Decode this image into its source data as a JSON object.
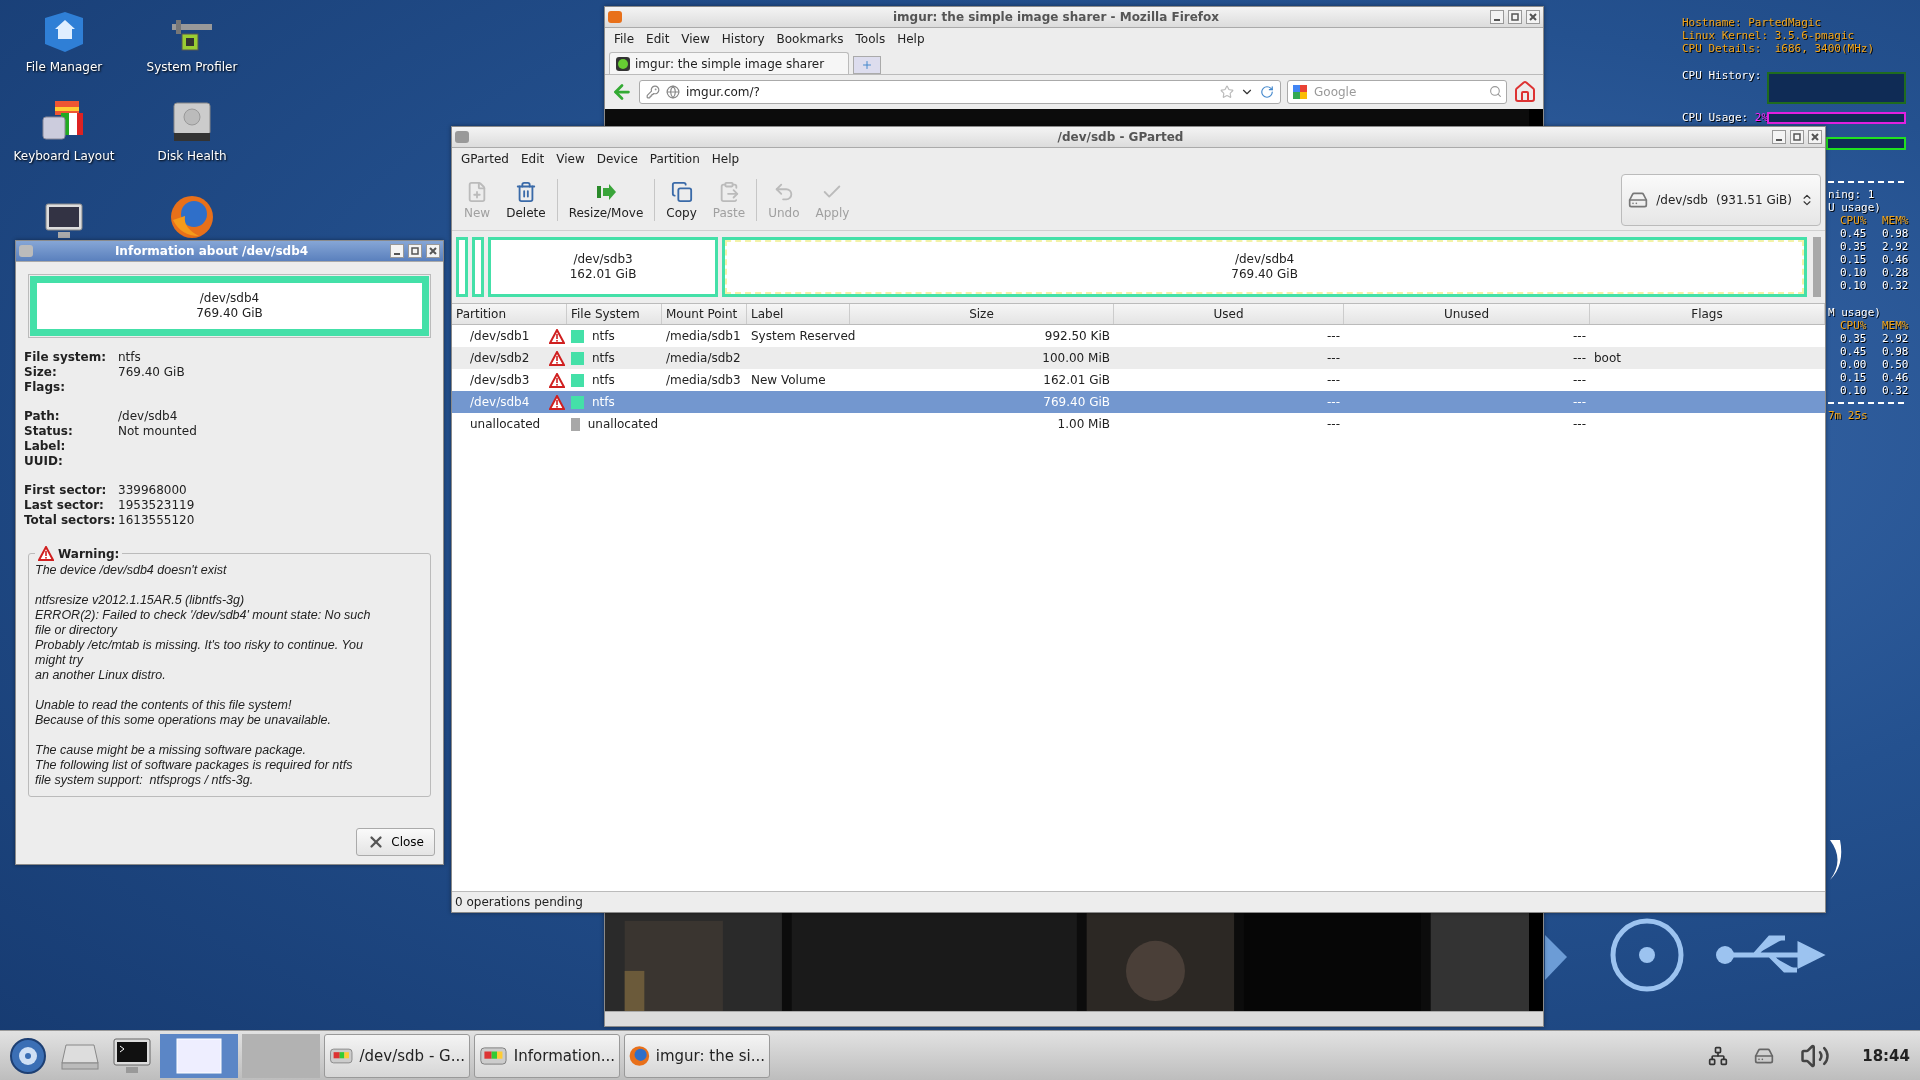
{
  "desktop_icons": [
    {
      "kind": "file_manager",
      "label": "File Manager"
    },
    {
      "kind": "profiler",
      "label": "System Profiler"
    },
    {
      "kind": "keyboard",
      "label": "Keyboard Layout"
    },
    {
      "kind": "disk",
      "label": "Disk Health"
    },
    {
      "kind": "monitor"
    },
    {
      "kind": "browser"
    }
  ],
  "system_monitor": {
    "info_lines": [
      "Hostname: PartedMagic",
      "Linux Kernel: 3.5.6-pmagic",
      "CPU Details:  i686, 3400(MHz)"
    ],
    "cpu_history_label": "CPU History:",
    "cpu_usage": {
      "label": "CPU Usage:",
      "value": "2%"
    },
    "running_fragment": "ning: 1",
    "tables": [
      {
        "heading": "U usage)",
        "columns": [
          "CPU%",
          "MEM%"
        ],
        "rows": [
          [
            "0.45",
            "0.98"
          ],
          [
            "0.35",
            "2.92"
          ],
          [
            "0.15",
            "0.46"
          ],
          [
            "0.10",
            "0.28"
          ],
          [
            "0.10",
            "0.32"
          ]
        ]
      },
      {
        "heading": "M usage)",
        "columns": [
          "CPU%",
          "MEM%"
        ],
        "rows": [
          [
            "0.35",
            "2.92"
          ],
          [
            "0.45",
            "0.98"
          ],
          [
            "0.00",
            "0.50"
          ],
          [
            "0.15",
            "0.46"
          ],
          [
            "0.10",
            "0.32"
          ]
        ]
      }
    ],
    "uptime_fragment": "7m 25s"
  },
  "firefox": {
    "title": "imgur: the simple image sharer - Mozilla Firefox",
    "menu": [
      "File",
      "Edit",
      "View",
      "History",
      "Bookmarks",
      "Tools",
      "Help"
    ],
    "tab": "imgur: the simple image sharer",
    "address": "imgur.com/?",
    "search_placeholder": "Google"
  },
  "gparted": {
    "title": "/dev/sdb - GParted",
    "menu": [
      "GParted",
      "Edit",
      "View",
      "Device",
      "Partition",
      "Help"
    ],
    "toolbar": [
      {
        "kind": "new",
        "label": "New",
        "disabled": true,
        "separator_after": false
      },
      {
        "kind": "delete",
        "label": "Delete",
        "disabled": false,
        "separator_after": true
      },
      {
        "kind": "resize",
        "label": "Resize/Move",
        "disabled": false,
        "separator_after": true
      },
      {
        "kind": "copy",
        "label": "Copy",
        "disabled": false,
        "separator_after": false
      },
      {
        "kind": "paste",
        "label": "Paste",
        "disabled": true,
        "separator_after": true
      },
      {
        "kind": "undo",
        "label": "Undo",
        "disabled": true,
        "separator_after": false
      },
      {
        "kind": "apply",
        "label": "Apply",
        "disabled": true,
        "separator_after": false
      }
    ],
    "device": {
      "name": "/dev/sdb",
      "size": "(931.51 GiB)"
    },
    "partition_map": [
      {
        "kind": "sliver",
        "selected": false
      },
      {
        "kind": "sliver",
        "selected": false
      },
      {
        "kind": "block",
        "name": "/dev/sdb3",
        "size": "162.01 GiB",
        "selected": false
      },
      {
        "kind": "block",
        "name": "/dev/sdb4",
        "size": "769.40 GiB",
        "selected": true
      }
    ],
    "columns": [
      "Partition",
      "File System",
      "Mount Point",
      "Label",
      "Size",
      "Used",
      "Unused",
      "Flags"
    ],
    "rows": [
      {
        "partition": "/dev/sdb1",
        "warning": true,
        "color": "#44e0a8",
        "file_system": "ntfs",
        "mount_point": "/media/sdb1",
        "label": "System Reserved",
        "size": "992.50 KiB",
        "used": "---",
        "unused": "---",
        "selected": false
      },
      {
        "partition": "/dev/sdb2",
        "warning": true,
        "color": "#44e0a8",
        "file_system": "ntfs",
        "mount_point": "/media/sdb2",
        "size": "100.00 MiB",
        "used": "---",
        "unused": "---",
        "flags": "boot",
        "selected": false
      },
      {
        "partition": "/dev/sdb3",
        "warning": true,
        "color": "#44e0a8",
        "file_system": "ntfs",
        "mount_point": "/media/sdb3",
        "label": "New Volume",
        "size": "162.01 GiB",
        "used": "---",
        "unused": "---",
        "selected": false
      },
      {
        "partition": "/dev/sdb4",
        "warning": true,
        "color": "#44e0a8",
        "file_system": "ntfs",
        "size": "769.40 GiB",
        "used": "---",
        "unused": "---",
        "selected": true
      },
      {
        "partition": "unallocated",
        "warning": false,
        "color": "#a8a8a8",
        "file_system": "unallocated",
        "size": "1.00 MiB",
        "used": "---",
        "unused": "---",
        "selected": false
      }
    ],
    "status": "0 operations pending"
  },
  "info_dialog": {
    "title": "Information about /dev/sdb4",
    "partition": {
      "name": "/dev/sdb4",
      "size": "769.40 GiB"
    },
    "details": [
      [
        {
          "label": "File system:",
          "value": "ntfs"
        },
        {
          "label": "Size:",
          "value": "769.40 GiB"
        },
        {
          "label": "Flags:"
        }
      ],
      [
        {
          "label": "Path:",
          "value": "/dev/sdb4"
        },
        {
          "label": "Status:",
          "value": "Not mounted"
        },
        {
          "label": "Label:"
        },
        {
          "label": "UUID:"
        }
      ],
      [
        {
          "label": "First sector:",
          "value": "339968000"
        },
        {
          "label": "Last sector:",
          "value": "1953523119"
        },
        {
          "label": "Total sectors:",
          "value": "1613555120"
        }
      ]
    ],
    "warning_title": "Warning:",
    "warning_paragraphs": [
      "The device /dev/sdb4 doesn't exist",
      "ntfsresize v2012.1.15AR.5 (libntfs-3g)\nERROR(2): Failed to check '/dev/sdb4' mount state: No such\nfile or directory\nProbably /etc/mtab is missing. It's too risky to continue. You\nmight try\nan another Linux distro.",
      "Unable to read the contents of this file system!\nBecause of this some operations may be unavailable.",
      "The cause might be a missing software package.\nThe following list of software packages is required for ntfs\nfile system support:  ntfsprogs / ntfs-3g."
    ],
    "close_button": "Close"
  },
  "taskbar": {
    "launchers": [
      {
        "kind": "start"
      },
      {
        "kind": "drive"
      },
      {
        "kind": "terminal"
      }
    ],
    "pager": [
      {
        "selected": true
      },
      {
        "selected": false
      }
    ],
    "tasks": [
      {
        "kind": "gparted",
        "label": "/dev/sdb - G..."
      },
      {
        "kind": "gparted",
        "label": "Information..."
      },
      {
        "kind": "browser",
        "label": "imgur: the si..."
      }
    ],
    "tray": [
      {
        "kind": "network"
      },
      {
        "kind": "drive"
      },
      {
        "kind": "volume"
      }
    ],
    "clock": "18:44"
  }
}
